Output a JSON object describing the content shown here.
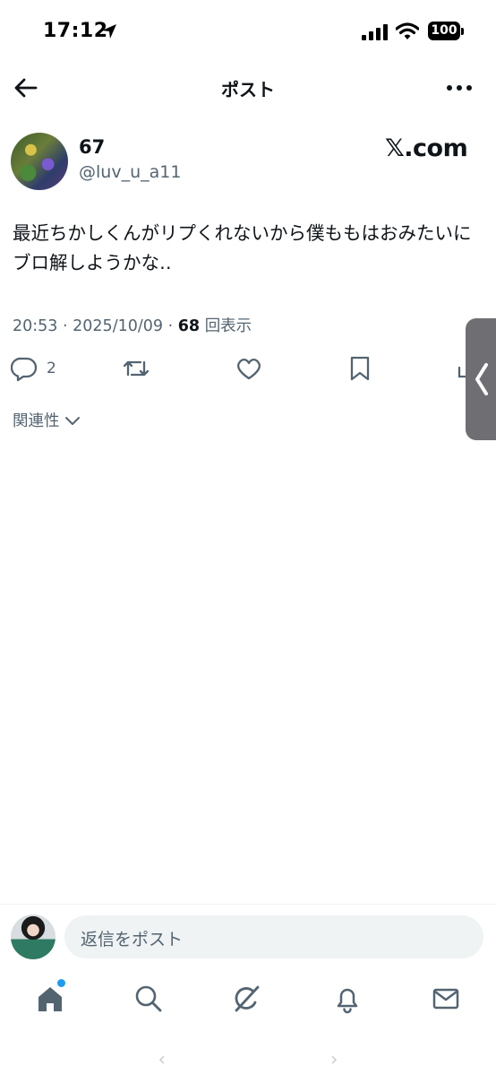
{
  "status_bar": {
    "time": "17:12",
    "battery": "100"
  },
  "nav": {
    "title": "ポスト"
  },
  "post": {
    "author_name": "67",
    "author_handle": "@luv_u_a11",
    "watermark": "𝕏.com",
    "text": "最近ちかしくんがリプくれないから僕ももはおみたいにブロ解しようかな‥",
    "time": "20:53",
    "date": "2025/10/09",
    "views_count": "68",
    "views_label": "回表示",
    "reply_count": "2"
  },
  "related_label": "関連性",
  "reply": {
    "placeholder": "返信をポスト"
  },
  "colors": {
    "text_primary": "#0f1419",
    "text_secondary": "#536471",
    "accent": "#1d9bf0",
    "side_tab": "#6f6f73"
  },
  "icons": {
    "back": "arrow-left-icon",
    "more": "more-horizontal-icon",
    "reply": "comment-icon",
    "repost": "repost-icon",
    "like": "heart-icon",
    "bookmark": "bookmark-icon",
    "share": "share-icon",
    "home": "home-icon",
    "search": "search-icon",
    "grok": "grok-icon",
    "notifications": "bell-icon",
    "messages": "envelope-icon"
  }
}
